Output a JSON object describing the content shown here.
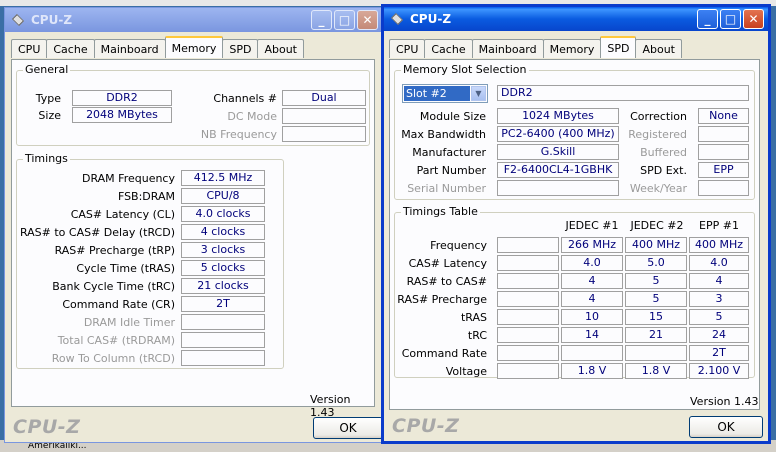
{
  "desktop": {
    "bottom_text": "Amerikaliki..."
  },
  "window_left": {
    "title": "CPU-Z",
    "tabs": [
      "CPU",
      "Cache",
      "Mainboard",
      "Memory",
      "SPD",
      "About"
    ],
    "selected_tab": "Memory",
    "general": {
      "title": "General",
      "type_label": "Type",
      "type_value": "DDR2",
      "size_label": "Size",
      "size_value": "2048 MBytes",
      "channels_label": "Channels #",
      "channels_value": "Dual",
      "dc_mode_label": "DC Mode",
      "dc_mode_value": "",
      "nb_freq_label": "NB Frequency",
      "nb_freq_value": ""
    },
    "timings": {
      "title": "Timings",
      "rows": [
        {
          "label": "DRAM Frequency",
          "value": "412.5 MHz",
          "dim": false
        },
        {
          "label": "FSB:DRAM",
          "value": "CPU/8",
          "dim": false
        },
        {
          "label": "CAS# Latency (CL)",
          "value": "4.0 clocks",
          "dim": false
        },
        {
          "label": "RAS# to CAS# Delay (tRCD)",
          "value": "4 clocks",
          "dim": false
        },
        {
          "label": "RAS# Precharge (tRP)",
          "value": "3 clocks",
          "dim": false
        },
        {
          "label": "Cycle Time (tRAS)",
          "value": "5 clocks",
          "dim": false
        },
        {
          "label": "Bank Cycle Time (tRC)",
          "value": "21 clocks",
          "dim": false
        },
        {
          "label": "Command Rate (CR)",
          "value": "2T",
          "dim": false
        },
        {
          "label": "DRAM Idle Timer",
          "value": "",
          "dim": true
        },
        {
          "label": "Total CAS# (tRDRAM)",
          "value": "",
          "dim": true
        },
        {
          "label": "Row To Column (tRCD)",
          "value": "",
          "dim": true
        }
      ]
    },
    "version": "Version 1.43",
    "brand": "CPU-Z",
    "ok_label": "OK"
  },
  "window_right": {
    "title": "CPU-Z",
    "tabs": [
      "CPU",
      "Cache",
      "Mainboard",
      "Memory",
      "SPD",
      "About"
    ],
    "selected_tab": "SPD",
    "slot": {
      "title": "Memory Slot Selection",
      "selected_slot": "Slot #2",
      "memory_type": "DDR2",
      "module_size_label": "Module Size",
      "module_size": "1024 MBytes",
      "max_bw_label": "Max Bandwidth",
      "max_bw": "PC2-6400 (400 MHz)",
      "manufacturer_label": "Manufacturer",
      "manufacturer": "G.Skill",
      "part_number_label": "Part Number",
      "part_number": "F2-6400CL4-1GBHK",
      "serial_label": "Serial Number",
      "serial": "",
      "correction_label": "Correction",
      "correction": "None",
      "registered_label": "Registered",
      "registered": "",
      "buffered_label": "Buffered",
      "buffered": "",
      "spd_ext_label": "SPD Ext.",
      "spd_ext": "EPP",
      "week_year_label": "Week/Year",
      "week_year": ""
    },
    "timings_table": {
      "title": "Timings Table",
      "columns": [
        "JEDEC #1",
        "JEDEC #2",
        "EPP #1"
      ],
      "rows": [
        {
          "label": "Frequency",
          "values": [
            "",
            "266 MHz",
            "400 MHz",
            "400 MHz"
          ]
        },
        {
          "label": "CAS# Latency",
          "values": [
            "",
            "4.0",
            "5.0",
            "4.0"
          ]
        },
        {
          "label": "RAS# to CAS#",
          "values": [
            "",
            "4",
            "5",
            "4"
          ]
        },
        {
          "label": "RAS# Precharge",
          "values": [
            "",
            "4",
            "5",
            "3"
          ]
        },
        {
          "label": "tRAS",
          "values": [
            "",
            "10",
            "15",
            "5"
          ]
        },
        {
          "label": "tRC",
          "values": [
            "",
            "14",
            "21",
            "24"
          ]
        },
        {
          "label": "Command Rate",
          "values": [
            "",
            "",
            "",
            "2T"
          ]
        },
        {
          "label": "Voltage",
          "values": [
            "",
            "1.8 V",
            "1.8 V",
            "2.100 V"
          ]
        }
      ]
    },
    "version": "Version 1.43",
    "brand": "CPU-Z",
    "ok_label": "OK"
  }
}
